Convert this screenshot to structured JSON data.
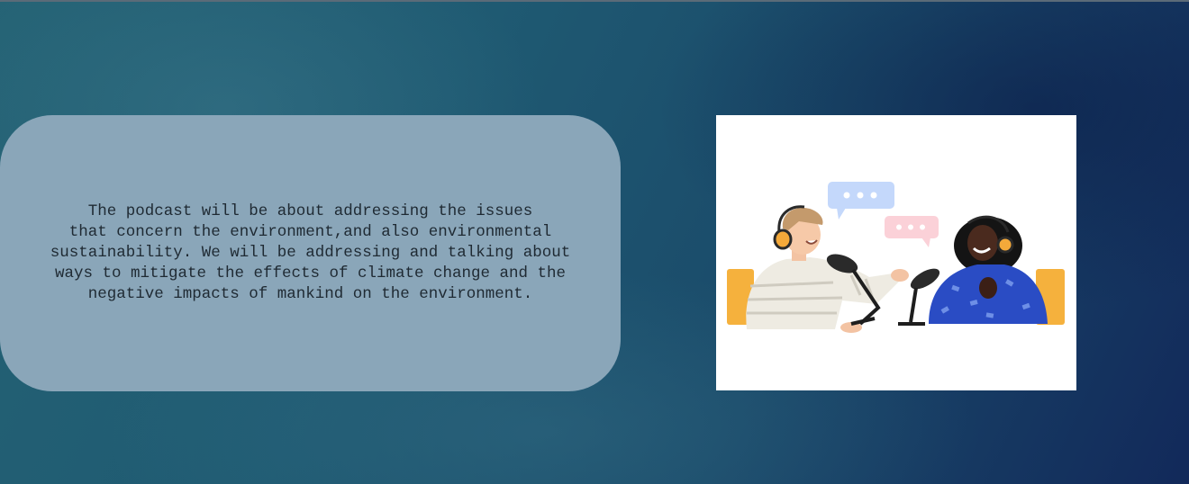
{
  "slide": {
    "description": "The podcast will be about addressing the issues\nthat concern the environment,and also environmental\nsustainability. We will be addressing and talking about\nways to mitigate the effects of climate change and the\nnegative impacts of mankind on the environment."
  },
  "illustration": {
    "icon": "podcast-illustration",
    "colors": {
      "chair": "#f5b13d",
      "bubble_blue": "#c4d8fb",
      "bubble_pink": "#fbd1d8",
      "sweater": "#eeebe2",
      "dress": "#2a4cc4",
      "headphones": "#f4a93a"
    }
  }
}
